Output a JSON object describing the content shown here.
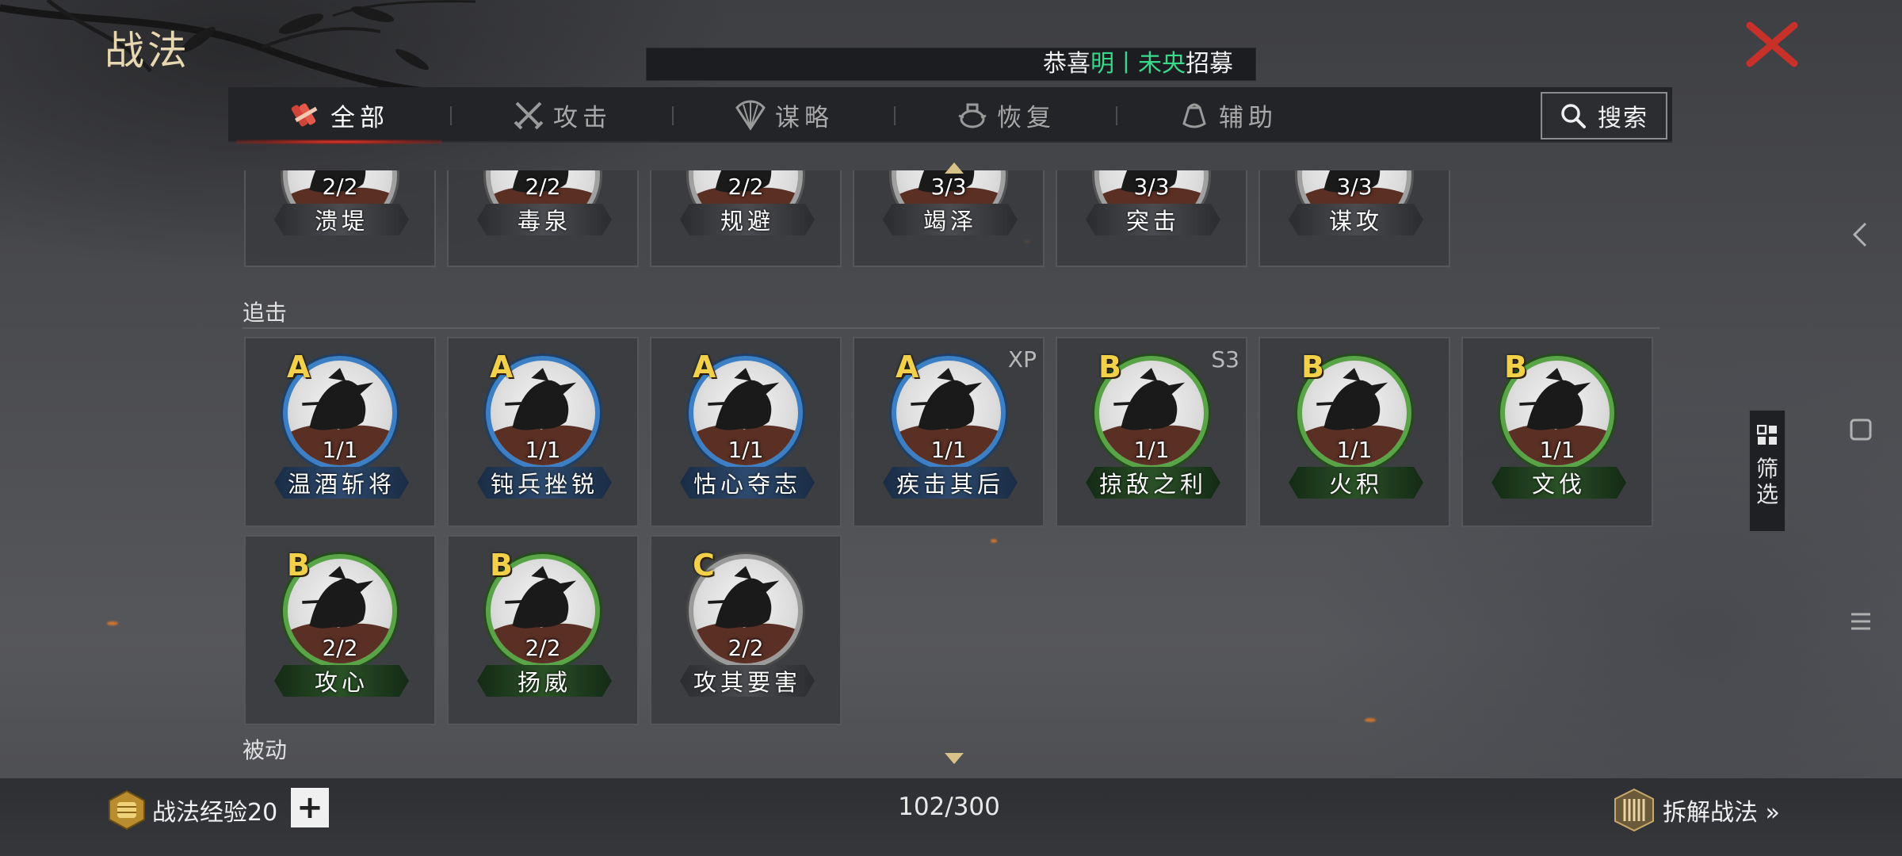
{
  "header": {
    "title": "战法",
    "marquee_prefix": "恭喜",
    "marquee_name1": "明",
    "marquee_sep": "丨",
    "marquee_name2": "未央",
    "marquee_suffix": "招募"
  },
  "tabs": [
    {
      "label": "全部",
      "icon": "scroll-bundle-icon",
      "active": true
    },
    {
      "label": "攻击",
      "icon": "crossed-swords-icon",
      "active": false
    },
    {
      "label": "谋略",
      "icon": "fan-icon",
      "active": false
    },
    {
      "label": "恢复",
      "icon": "medicine-pot-icon",
      "active": false
    },
    {
      "label": "辅助",
      "icon": "pouch-icon",
      "active": false
    }
  ],
  "search": {
    "label": "搜索",
    "icon": "search-icon"
  },
  "top_row": [
    {
      "count": "2/2",
      "name": "溃堤"
    },
    {
      "count": "2/2",
      "name": "毒泉"
    },
    {
      "count": "2/2",
      "name": "规避"
    },
    {
      "count": "3/3",
      "name": "竭泽"
    },
    {
      "count": "3/3",
      "name": "突击"
    },
    {
      "count": "3/3",
      "name": "谋攻"
    }
  ],
  "sections": {
    "pursuit": "追击",
    "passive": "被动"
  },
  "pursuit_row1": [
    {
      "grade": "A",
      "count": "1/1",
      "name": "温酒斩将",
      "ring": "blue",
      "tag": ""
    },
    {
      "grade": "A",
      "count": "1/1",
      "name": "钝兵挫锐",
      "ring": "blue",
      "tag": ""
    },
    {
      "grade": "A",
      "count": "1/1",
      "name": "怙心夺志",
      "ring": "blue",
      "tag": ""
    },
    {
      "grade": "A",
      "count": "1/1",
      "name": "疾击其后",
      "ring": "blue",
      "tag": "XP"
    },
    {
      "grade": "B",
      "count": "1/1",
      "name": "掠敌之利",
      "ring": "green",
      "tag": "S3"
    },
    {
      "grade": "B",
      "count": "1/1",
      "name": "火积",
      "ring": "green",
      "tag": ""
    },
    {
      "grade": "B",
      "count": "1/1",
      "name": "文伐",
      "ring": "green",
      "tag": ""
    }
  ],
  "pursuit_row2": [
    {
      "grade": "B",
      "count": "2/2",
      "name": "攻心",
      "ring": "green",
      "tag": ""
    },
    {
      "grade": "B",
      "count": "2/2",
      "name": "扬威",
      "ring": "green",
      "tag": ""
    },
    {
      "grade": "C",
      "count": "2/2",
      "name": "攻其要害",
      "ring": "gray",
      "tag": ""
    }
  ],
  "footer": {
    "exp_label": "战法经验20",
    "plus": "+",
    "capacity": "102/300",
    "dismantle": "拆解战法 »"
  },
  "filter": {
    "label_1": "筛",
    "label_2": "选"
  },
  "colors": {
    "grade": "#f3d04a",
    "ring_blue": "#3c7fc4",
    "ring_green": "#58a447",
    "accent_red": "#e5362a",
    "marquee_highlight": "#38d98a"
  }
}
